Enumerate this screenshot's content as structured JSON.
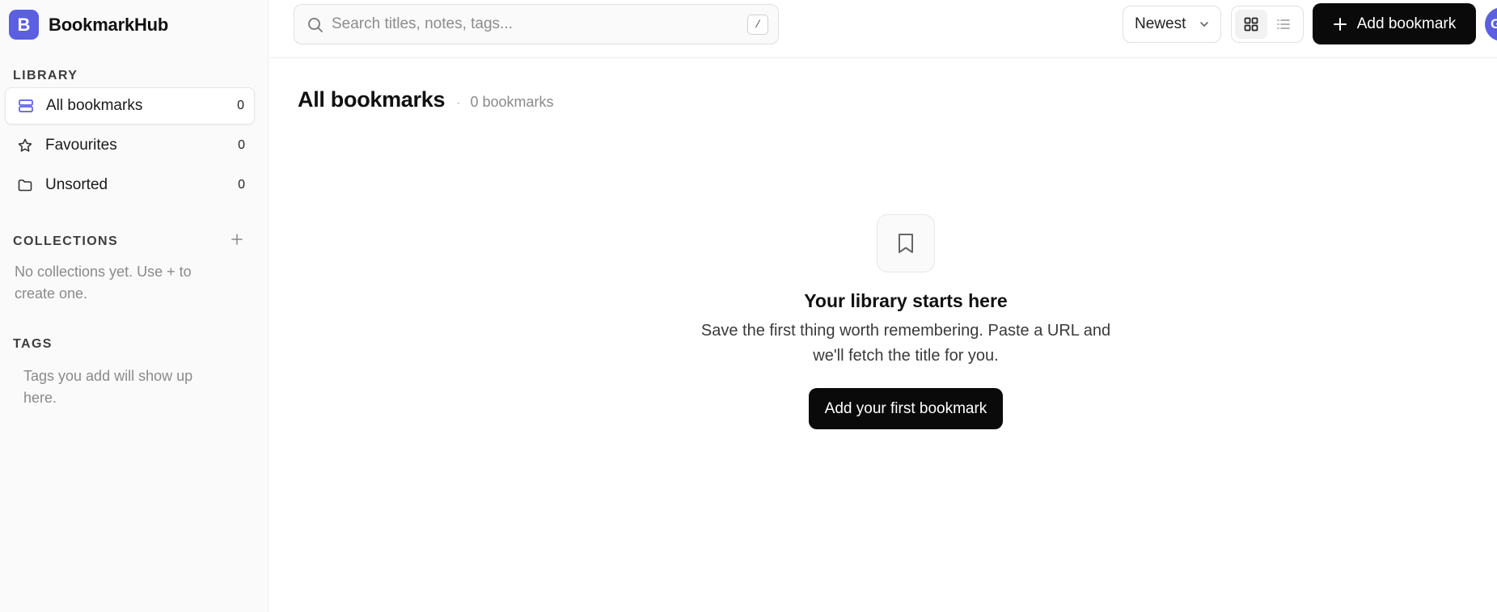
{
  "brand": {
    "logo_letter": "B",
    "name": "BookmarkHub",
    "accent": "#5b5fe0"
  },
  "sidebar": {
    "library_label": "LIBRARY",
    "items": [
      {
        "label": "All bookmarks",
        "count": "0",
        "icon": "stack-icon",
        "active": true
      },
      {
        "label": "Favourites",
        "count": "0",
        "icon": "star-icon",
        "active": false
      },
      {
        "label": "Unsorted",
        "count": "0",
        "icon": "folder-icon",
        "active": false
      }
    ],
    "collections_label": "COLLECTIONS",
    "collections_empty": "No collections yet. Use + to create one.",
    "tags_label": "TAGS",
    "tags_empty": "Tags you add will show up here."
  },
  "topbar": {
    "search_placeholder": "Search titles, notes, tags...",
    "search_value": "",
    "search_shortcut": "/",
    "sort_label": "Newest",
    "view_mode": "grid",
    "add_label": "Add bookmark",
    "avatar_initial": "G"
  },
  "main": {
    "title": "All bookmarks",
    "separator": "·",
    "count_text": "0 bookmarks",
    "empty_title": "Your library starts here",
    "empty_desc": "Save the first thing worth remembering. Paste a URL and we'll fetch the title for you.",
    "empty_button": "Add your first bookmark"
  }
}
